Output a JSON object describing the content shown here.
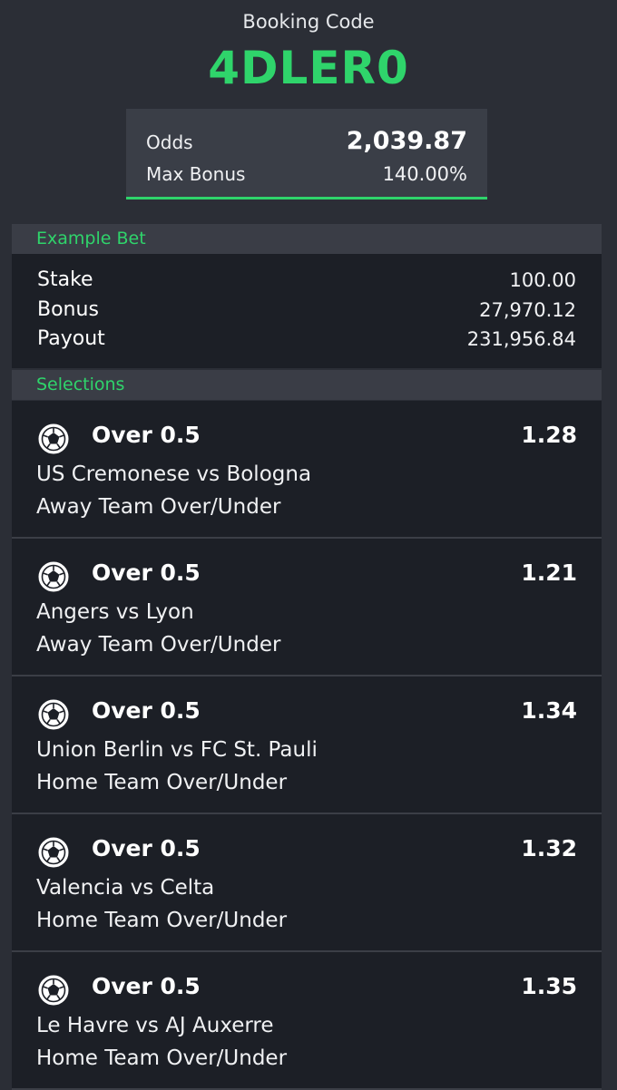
{
  "header": {
    "booking_label": "Booking Code",
    "booking_code": "4DLER0",
    "accent_color": "#2fd46b"
  },
  "odds_summary": {
    "odds_label": "Odds",
    "odds_value": "2,039.87",
    "bonus_label": "Max Bonus",
    "bonus_value": "140.00%"
  },
  "example_bet": {
    "title": "Example Bet",
    "rows": [
      {
        "label": "Stake",
        "value": "100.00"
      },
      {
        "label": "Bonus",
        "value": "27,970.12"
      },
      {
        "label": "Payout",
        "value": "231,956.84"
      }
    ]
  },
  "selections": {
    "title": "Selections",
    "items": [
      {
        "icon": "soccer-ball-icon",
        "name": "Over 0.5",
        "odds": "1.28",
        "match": "US Cremonese vs Bologna",
        "market": "Away Team Over/Under"
      },
      {
        "icon": "soccer-ball-icon",
        "name": "Over 0.5",
        "odds": "1.21",
        "match": "Angers vs Lyon",
        "market": "Away Team Over/Under"
      },
      {
        "icon": "soccer-ball-icon",
        "name": "Over 0.5",
        "odds": "1.34",
        "match": "Union Berlin vs FC St. Pauli",
        "market": "Home Team Over/Under"
      },
      {
        "icon": "soccer-ball-icon",
        "name": "Over 0.5",
        "odds": "1.32",
        "match": "Valencia vs Celta",
        "market": "Home Team Over/Under"
      },
      {
        "icon": "soccer-ball-icon",
        "name": "Over 0.5",
        "odds": "1.35",
        "match": "Le Havre vs AJ Auxerre",
        "market": "Home Team Over/Under"
      }
    ]
  }
}
